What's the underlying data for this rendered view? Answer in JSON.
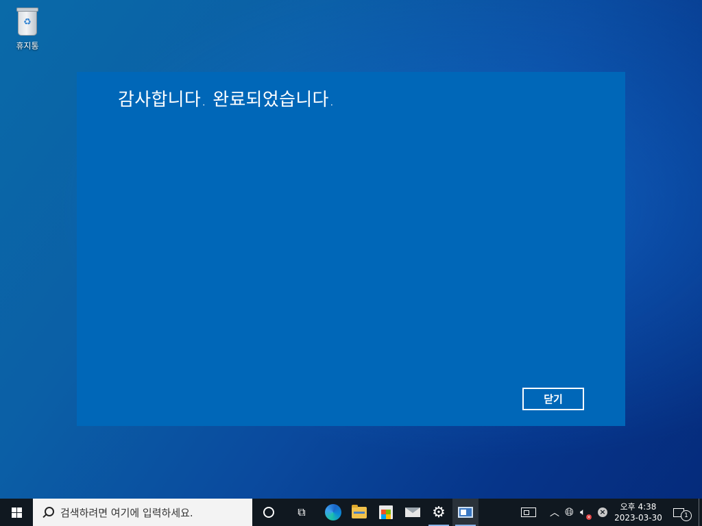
{
  "desktop": {
    "icons": [
      {
        "label": "휴지통",
        "icon": "recycle-bin-icon"
      }
    ]
  },
  "dialog": {
    "title": "감사합니다. 완료되었습니다.",
    "close_label": "닫기",
    "background": "#0067b8"
  },
  "taskbar": {
    "search_placeholder": "검색하려면 여기에 입력하세요.",
    "pinned": [
      {
        "name": "edge",
        "icon": "edge-icon"
      },
      {
        "name": "file-explorer",
        "icon": "folder-icon"
      },
      {
        "name": "microsoft-store",
        "icon": "store-icon"
      },
      {
        "name": "mail",
        "icon": "mail-icon"
      },
      {
        "name": "settings",
        "icon": "gear-icon"
      },
      {
        "name": "active-app",
        "icon": "window-app-icon"
      }
    ],
    "clock": {
      "time": "오후 4:38",
      "date": "2023-03-30"
    },
    "notification_count": "1"
  }
}
